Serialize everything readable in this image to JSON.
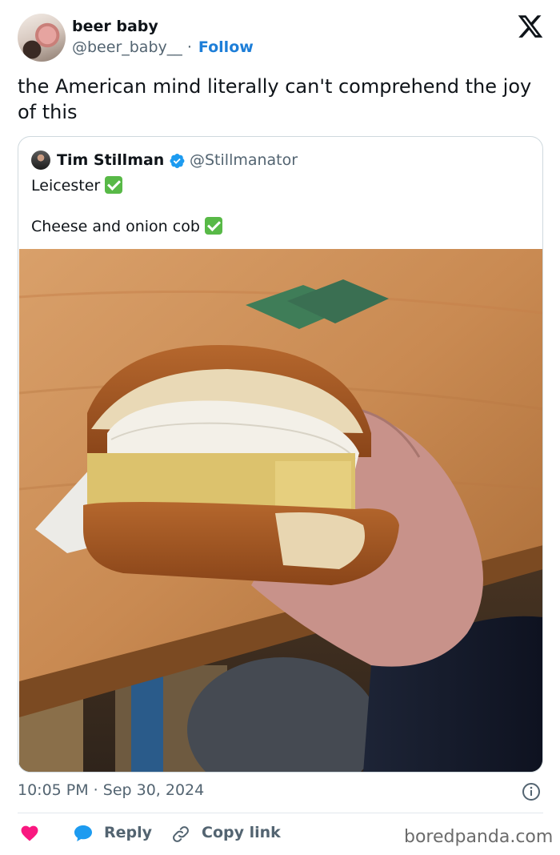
{
  "author": {
    "display_name": "beer baby",
    "handle": "@beer_baby__",
    "separator": "·",
    "follow_label": "Follow"
  },
  "tweet": {
    "text": "the American mind literally can't comprehend the joy of this",
    "timestamp": "10:05 PM · Sep 30, 2024"
  },
  "quoted_tweet": {
    "display_name": "Tim Stillman",
    "handle": "@Stillmanator",
    "verified": true,
    "lines": [
      "Leicester",
      "Cheese and onion cob"
    ]
  },
  "actions": {
    "reply_label": "Reply",
    "copy_link_label": "Copy link"
  },
  "watermark": "boredpanda.com",
  "icons": {
    "brand": "x-logo-icon",
    "info": "info-icon",
    "like": "heart-icon",
    "reply": "speech-bubble-icon",
    "copy": "link-icon",
    "check": "check-mark-icon",
    "verified": "verified-badge-icon"
  },
  "colors": {
    "accent": "#1d7ed8",
    "heart": "#f91880",
    "secondary_text": "#536471",
    "check": "#58b947"
  }
}
